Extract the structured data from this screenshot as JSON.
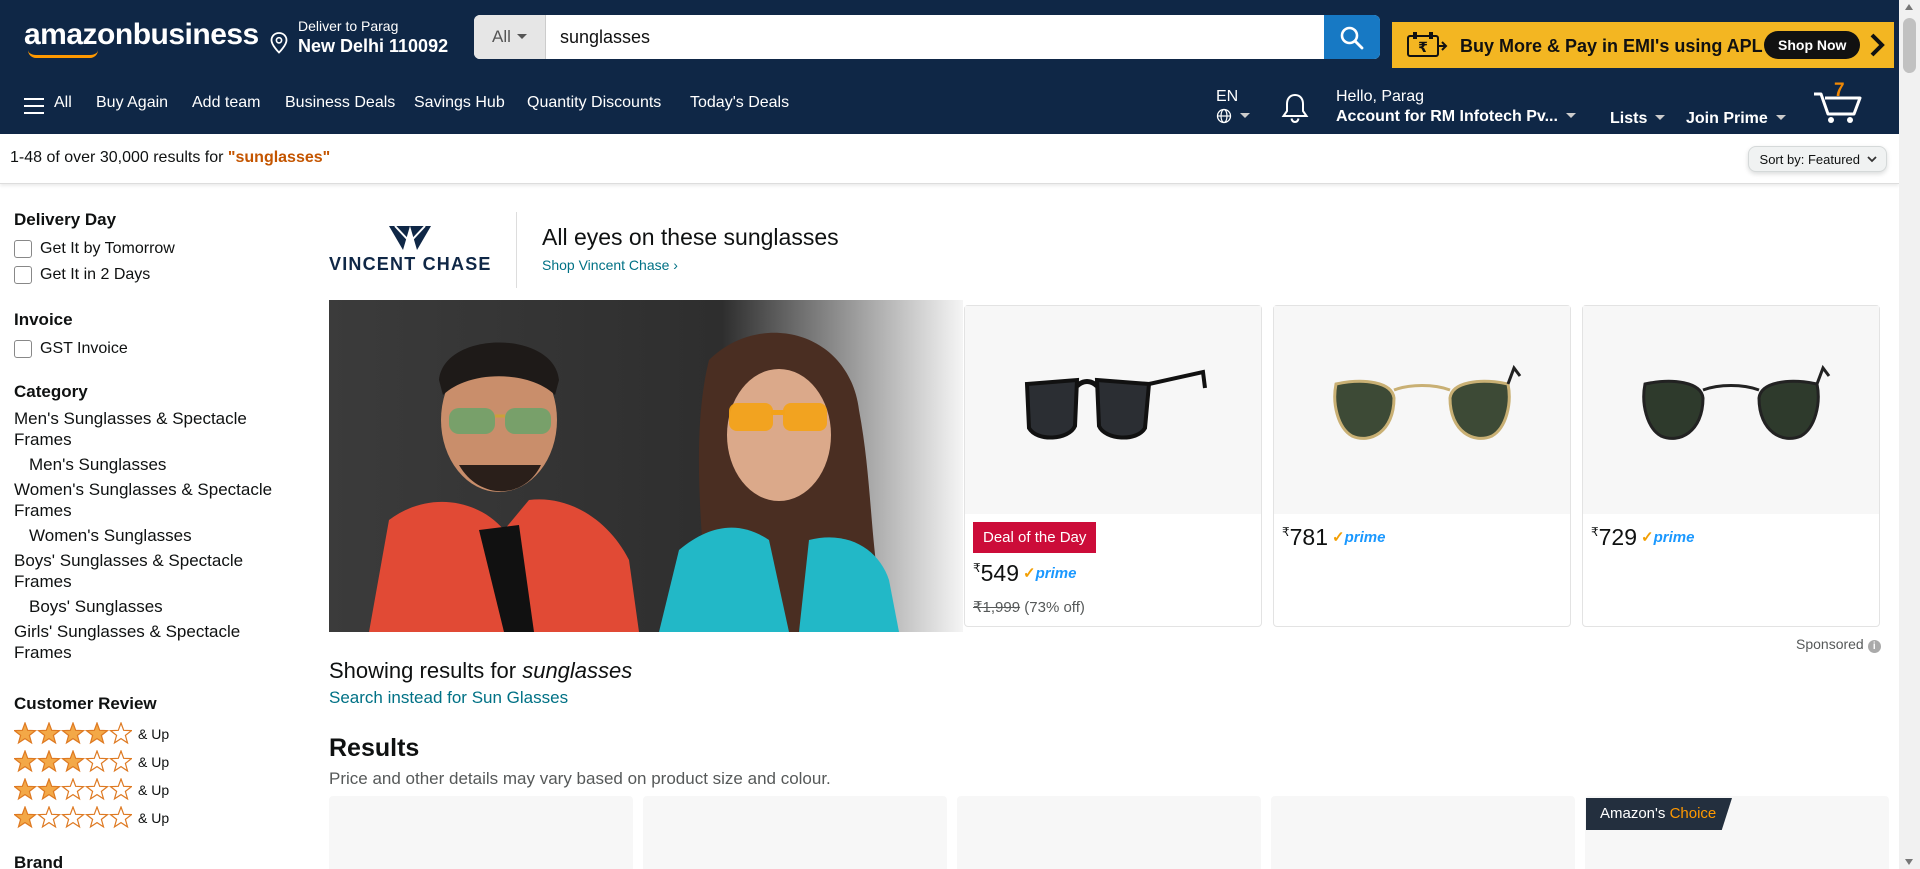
{
  "header": {
    "logo": "amazonbusiness",
    "deliver_line1": "Deliver to Parag",
    "deliver_line2": "New Delhi 110092",
    "search_category": "All",
    "search_value": "sunglasses",
    "promo_text": "Buy More & Pay in EMI's using APL",
    "promo_button": "Shop Now"
  },
  "nav": {
    "all": "All",
    "items": [
      "Buy Again",
      "Add team",
      "Business Deals",
      "Savings Hub",
      "Quantity Discounts",
      "Today's Deals"
    ],
    "lang": "EN",
    "hello": "Hello, Parag",
    "account": "Account for RM Infotech Pv...",
    "lists": "Lists",
    "join_prime": "Join Prime",
    "cart_count": "7"
  },
  "results_bar": {
    "count_text": "1-48 of over 30,000 results for ",
    "query": "\"sunglasses\"",
    "sort_label": "Sort by:",
    "sort_value": "Featured"
  },
  "sidebar": {
    "delivery_title": "Delivery Day",
    "delivery_options": [
      "Get It by Tomorrow",
      "Get It in 2 Days"
    ],
    "invoice_title": "Invoice",
    "invoice_options": [
      "GST Invoice"
    ],
    "category_title": "Category",
    "categories": [
      {
        "label": "Men's Sunglasses & Spectacle Frames",
        "sub": false
      },
      {
        "label": "Men's Sunglasses",
        "sub": true
      },
      {
        "label": "Women's Sunglasses & Spectacle Frames",
        "sub": false
      },
      {
        "label": "Women's Sunglasses",
        "sub": true
      },
      {
        "label": "Boys' Sunglasses & Spectacle Frames",
        "sub": false
      },
      {
        "label": "Boys' Sunglasses",
        "sub": true
      },
      {
        "label": "Girls' Sunglasses & Spectacle Frames",
        "sub": false
      }
    ],
    "review_title": "Customer Review",
    "review_ratings": [
      4,
      3,
      2,
      1
    ],
    "review_suffix": "& Up",
    "brand_title": "Brand"
  },
  "banner": {
    "brand_wordmark": "VINCENT CHASE",
    "title": "All eyes on these sunglasses",
    "link": "Shop Vincent Chase ›",
    "products": [
      {
        "deal": "Deal of the Day",
        "currency": "₹",
        "price": "549",
        "prime": "prime",
        "mrp": "₹1,999",
        "off": "(73% off)",
        "style": "black-square"
      },
      {
        "deal": "",
        "currency": "₹",
        "price": "781",
        "prime": "prime",
        "mrp": "",
        "off": "",
        "style": "gold-aviator"
      },
      {
        "deal": "",
        "currency": "₹",
        "price": "729",
        "prime": "prime",
        "mrp": "",
        "off": "",
        "style": "black-aviator"
      }
    ],
    "sponsored": "Sponsored"
  },
  "main": {
    "showing_prefix": "Showing results for ",
    "showing_query": "sunglasses",
    "instead": "Search instead for Sun Glasses",
    "results_title": "Results",
    "results_sub": "Price and other details may vary based on product size and colour.",
    "choice_amazon": "Amazon's",
    "choice_word": "Choice"
  },
  "colors": {
    "nav_bg": "#0f2746",
    "search_button": "#1779c4",
    "promo_bg": "#f3b622",
    "deal_red": "#cc0c39",
    "link_teal": "#007185",
    "star_orange": "#f3a847"
  }
}
